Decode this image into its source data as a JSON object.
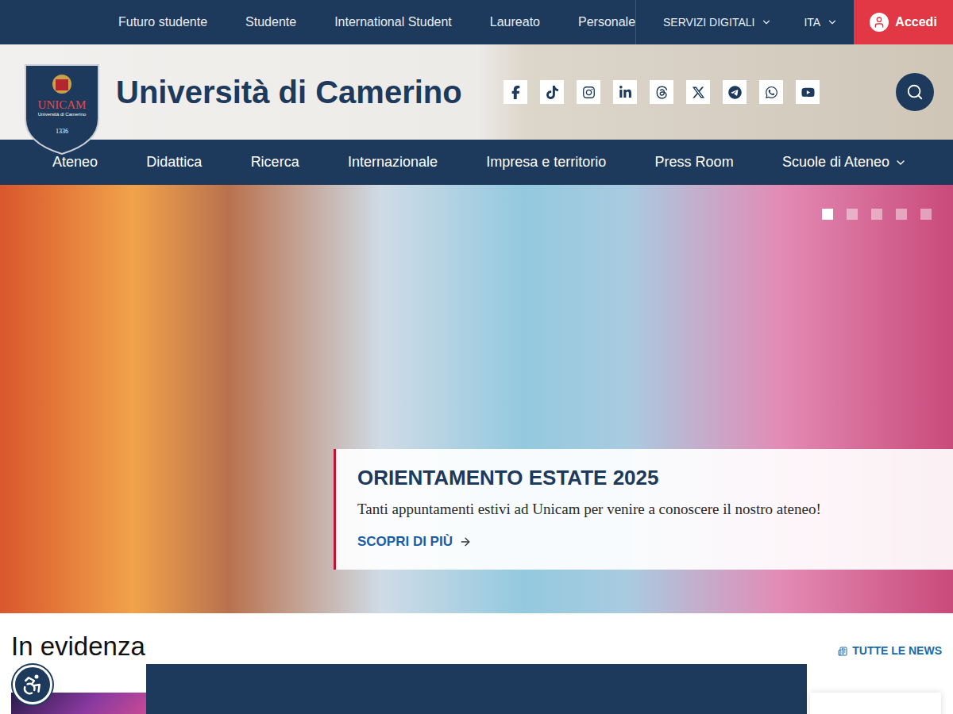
{
  "top_bar": {
    "links": [
      "Futuro studente",
      "Studente",
      "International Student",
      "Laureato",
      "Personale"
    ],
    "digital_services": "SERVIZI DIGITALI",
    "language": "ITA",
    "login": "Accedi"
  },
  "header": {
    "logo": {
      "name": "UNICAM",
      "subtitle": "Università di Camerino",
      "year": "1336"
    },
    "title": "Università di Camerino"
  },
  "main_nav": [
    {
      "label": "Ateneo",
      "has_menu": false
    },
    {
      "label": "Didattica",
      "has_menu": false
    },
    {
      "label": "Ricerca",
      "has_menu": false
    },
    {
      "label": "Internazionale",
      "has_menu": false
    },
    {
      "label": "Impresa e territorio",
      "has_menu": false
    },
    {
      "label": "Press Room",
      "has_menu": false
    },
    {
      "label": "Scuole di Ateneo",
      "has_menu": true
    }
  ],
  "hero": {
    "slides": [
      {
        "selected": true
      },
      {
        "selected": false
      },
      {
        "selected": false
      },
      {
        "selected": false
      },
      {
        "selected": false
      }
    ],
    "title": "ORIENTAMENTO ESTATE 2025",
    "text": "Tanti appuntamenti estivi ad Unicam per venire a conoscere il nostro ateneo!",
    "link": "SCOPRI DI PIÙ"
  },
  "news": {
    "heading": "In evidenza",
    "all_link": "TUTTE LE NEWS"
  }
}
